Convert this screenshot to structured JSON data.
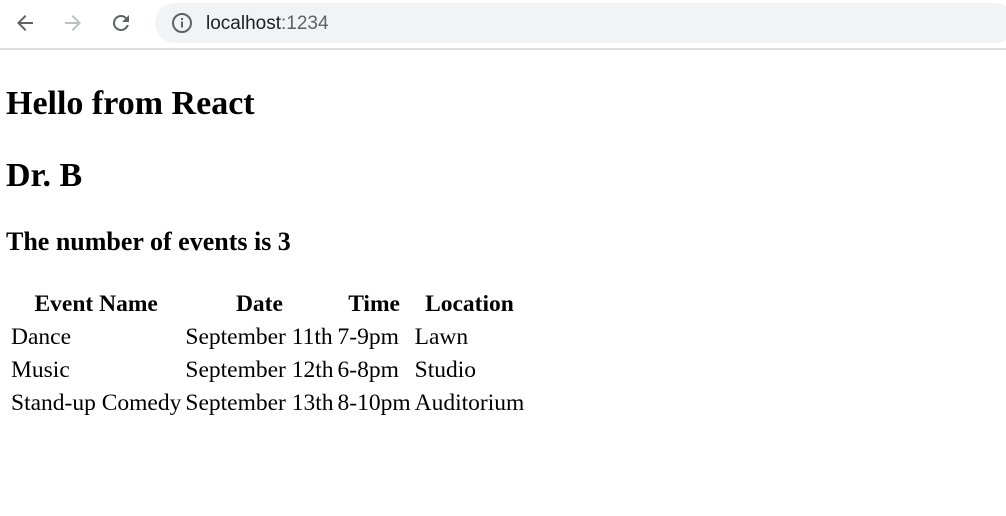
{
  "browser": {
    "url_host": "localhost",
    "url_port": ":1234"
  },
  "page": {
    "title": "Hello from React",
    "name": "Dr. B",
    "events_count_text": "The number of events is 3"
  },
  "table": {
    "headers": [
      "Event Name",
      "Date",
      "Time",
      "Location"
    ],
    "rows": [
      [
        "Dance",
        "September 11th",
        "7-9pm",
        "Lawn"
      ],
      [
        "Music",
        "September 12th",
        "6-8pm",
        "Studio"
      ],
      [
        "Stand-up Comedy",
        "September 13th",
        "8-10pm",
        "Auditorium"
      ]
    ]
  }
}
